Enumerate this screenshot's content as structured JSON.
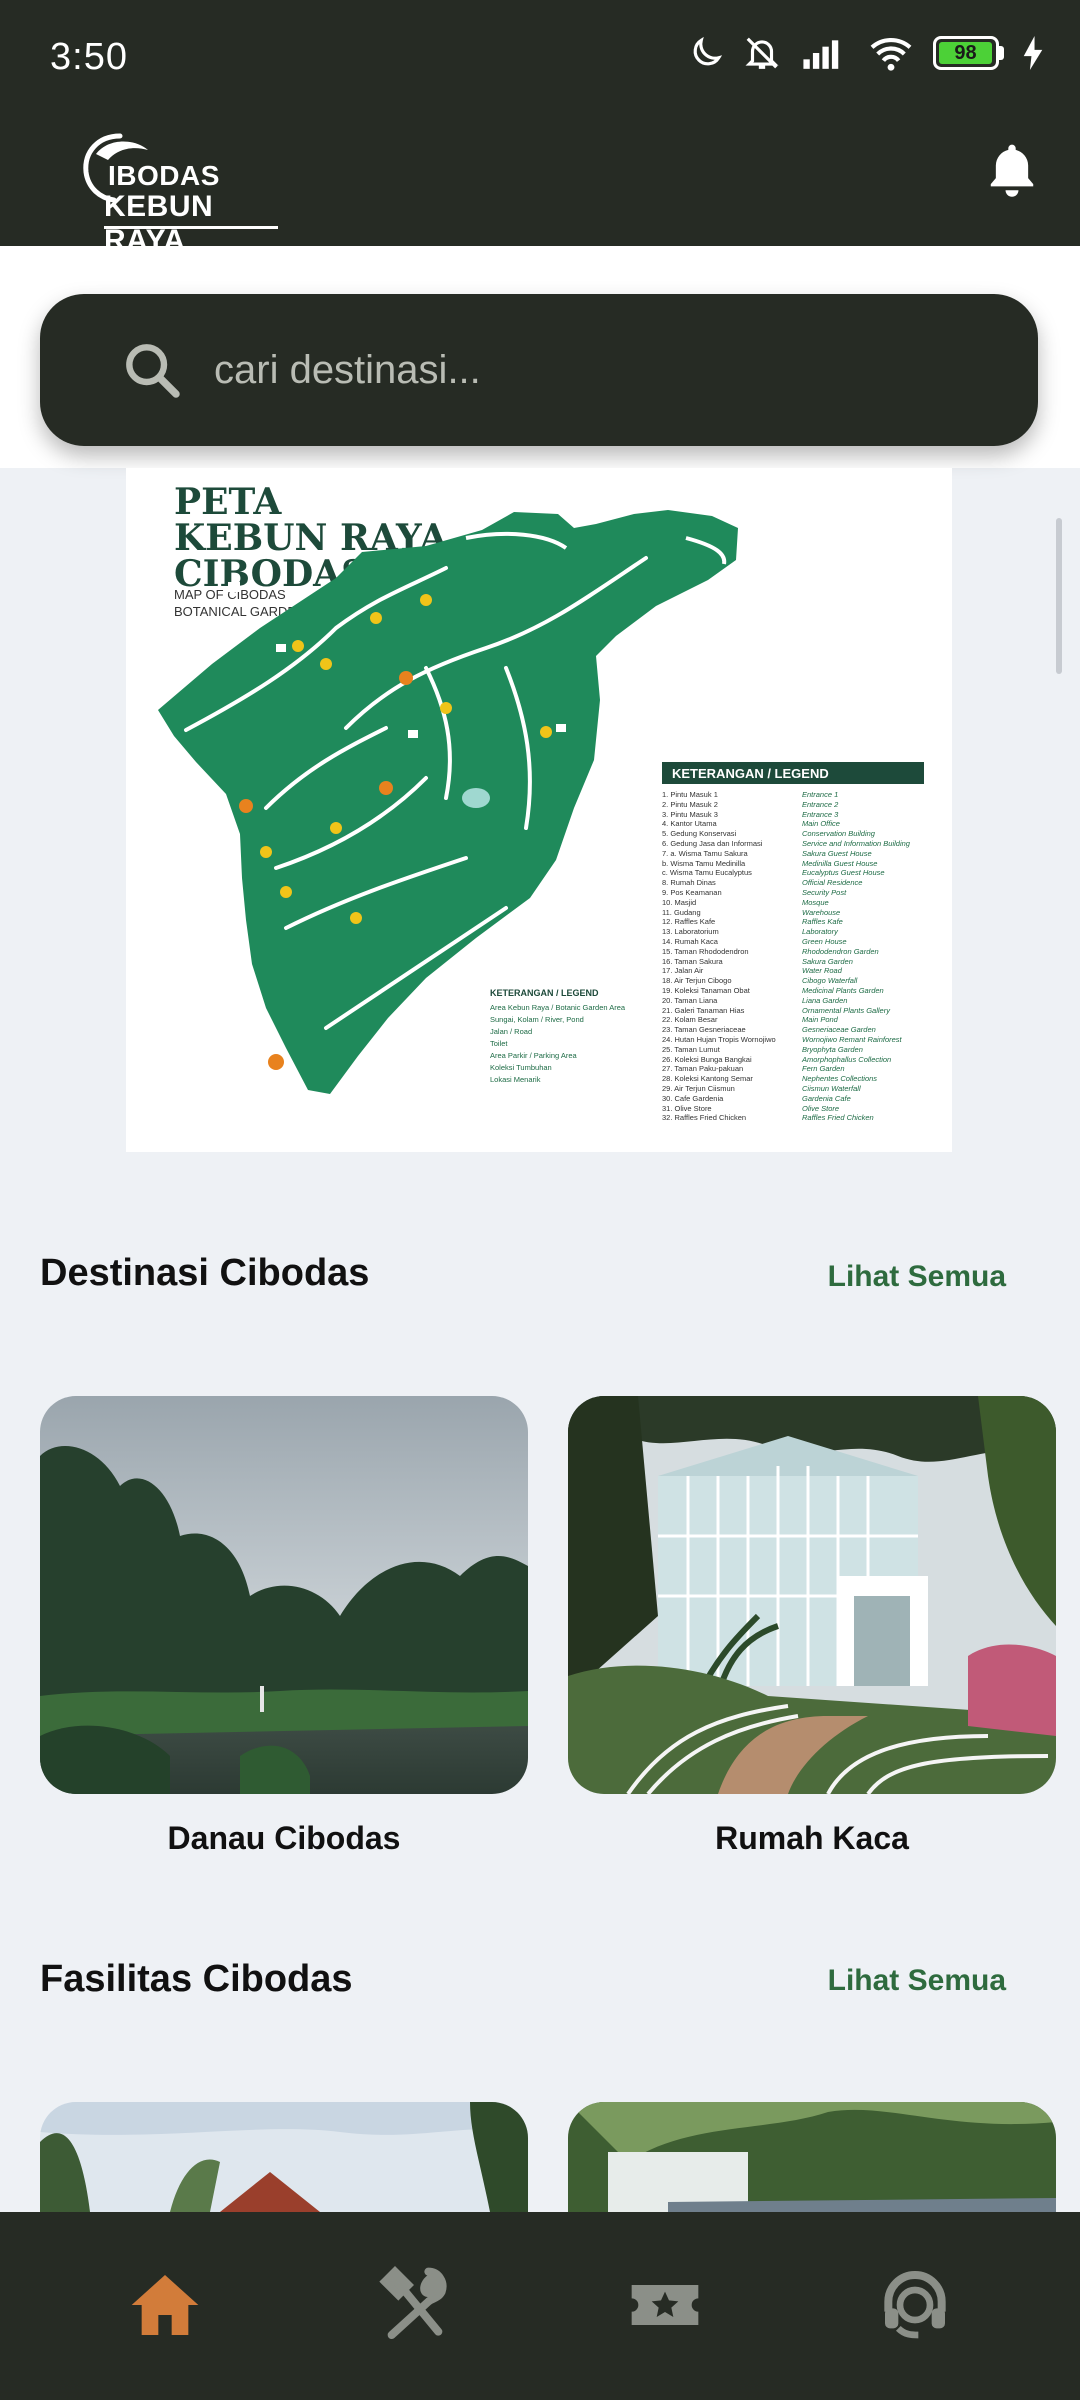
{
  "status_bar": {
    "time": "3:50",
    "battery": "98"
  },
  "header": {
    "logo_line1": "IBODAS",
    "logo_line2": "KEBUN RAYA",
    "notification_icon": "bell-icon"
  },
  "search": {
    "placeholder": "cari destinasi..."
  },
  "map": {
    "title_line1": "PETA",
    "title_line2": "KEBUN RAYA",
    "title_line3": "CIBODAS",
    "subtitle_line1": "MAP OF CIBODAS",
    "subtitle_line2": "BOTANICAL GARDEN",
    "legend_title": "KETERANGAN / LEGEND",
    "legend": [
      [
        "1. Pintu Masuk 1",
        "Entrance 1"
      ],
      [
        "2. Pintu Masuk 2",
        "Entrance 2"
      ],
      [
        "3. Pintu Masuk 3",
        "Entrance 3"
      ],
      [
        "4. Kantor Utama",
        "Main Office"
      ],
      [
        "5. Gedung Konservasi",
        "Conservation Building"
      ],
      [
        "6. Gedung Jasa dan Informasi",
        "Service and Information Building"
      ],
      [
        "7. a. Wisma Tamu Sakura",
        "Sakura Guest House"
      ],
      [
        "b. Wisma Tamu Medinilla",
        "Medinilla Guest House"
      ],
      [
        "c. Wisma Tamu Eucalyptus",
        "Eucalyptus Guest House"
      ],
      [
        "8. Rumah Dinas",
        "Official Residence"
      ],
      [
        "9. Pos Keamanan",
        "Security Post"
      ],
      [
        "10. Masjid",
        "Mosque"
      ],
      [
        "11. Gudang",
        "Warehouse"
      ],
      [
        "12. Raffles Kafe",
        "Raffles Kafe"
      ],
      [
        "13. Laboratorium",
        "Laboratory"
      ],
      [
        "14. Rumah Kaca",
        "Green House"
      ],
      [
        "15. Taman Rhododendron",
        "Rhododendron Garden"
      ],
      [
        "16. Taman Sakura",
        "Sakura Garden"
      ],
      [
        "17. Jalan Air",
        "Water Road"
      ],
      [
        "18. Air Terjun Cibogo",
        "Cibogo Waterfall"
      ],
      [
        "19. Koleksi Tanaman Obat",
        "Medicinal Plants Garden"
      ],
      [
        "20. Taman Liana",
        "Liana Garden"
      ],
      [
        "21. Galeri Tanaman Hias",
        "Ornamental Plants Gallery"
      ],
      [
        "22. Kolam Besar",
        "Main Pond"
      ],
      [
        "23. Taman Gesneriaceae",
        "Gesneriaceae Garden"
      ],
      [
        "24. Hutan Hujan Tropis Wornojiwo",
        "Wornojiwo Remant Rainforest"
      ],
      [
        "25. Taman Lumut",
        "Bryophyta Garden"
      ],
      [
        "26. Koleksi Bunga Bangkai",
        "Amorphophallus Collection"
      ],
      [
        "27. Taman Paku-pakuan",
        "Fern Garden"
      ],
      [
        "28. Koleksi Kantong Semar",
        "Nephentes Collections"
      ],
      [
        "29. Air Terjun Ciismun",
        "Ciismun Waterfall"
      ],
      [
        "30. Cafe Gardenia",
        "Gardenia Cafe"
      ],
      [
        "31. Olive Store",
        "Olive Store"
      ],
      [
        "32. Raffles Fried Chicken",
        "Raffles Fried Chicken"
      ]
    ],
    "mini_legend_title": "KETERANGAN / LEGEND",
    "mini_legend": [
      "Area Kebun Raya / Botanic Garden Area",
      "Sungai, Kolam / River, Pond",
      "Jalan / Road",
      "Toilet",
      "Area Parkir / Parking Area",
      "Koleksi Tumbuhan",
      "Lokasi Menarik"
    ]
  },
  "sections": {
    "destinations": {
      "title": "Destinasi Cibodas",
      "see_all": "Lihat Semua",
      "items": [
        {
          "label": "Danau Cibodas"
        },
        {
          "label": "Rumah Kaca"
        }
      ]
    },
    "facilities": {
      "title": "Fasilitas Cibodas",
      "see_all": "Lihat Semua"
    }
  },
  "bottom_nav": [
    {
      "icon": "home-icon",
      "active": true
    },
    {
      "icon": "dining-icon",
      "active": false
    },
    {
      "icon": "ticket-icon",
      "active": false
    },
    {
      "icon": "support-icon",
      "active": false
    }
  ],
  "colors": {
    "header_bg": "#262b24",
    "accent_orange": "#d27c3a",
    "link_green": "#2e6b3e",
    "map_green": "#1f8a5b",
    "page_bg": "#eef1f5"
  }
}
